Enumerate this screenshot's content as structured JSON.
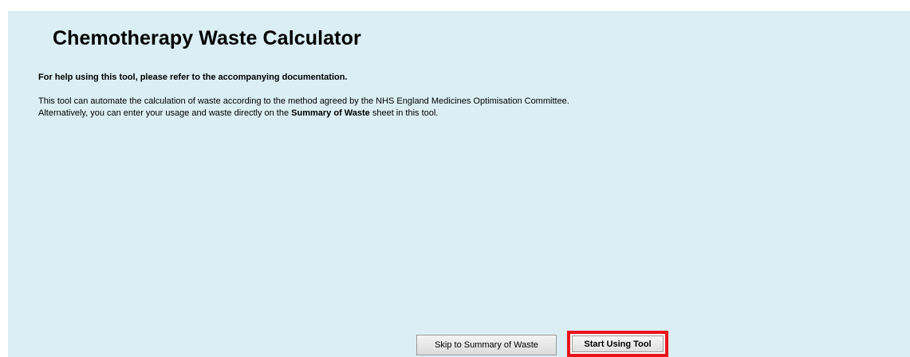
{
  "page": {
    "title": "Chemotherapy Waste Calculator",
    "help_text": "For help using this tool, please refer to the accompanying documentation.",
    "paragraph1": "This tool can automate the calculation of waste according to the method agreed by the NHS England Medicines Optimisation Committee.",
    "paragraph2_before": "Alternatively, you can enter your usage and waste directly on the ",
    "paragraph2_bold": "Summary of Waste",
    "paragraph2_after": " sheet in this tool."
  },
  "buttons": {
    "skip_label": "Skip to Summary of Waste",
    "start_label": "Start Using Tool"
  },
  "colors": {
    "sheet_background": "#daeef3",
    "highlight_border": "#e8141b"
  }
}
